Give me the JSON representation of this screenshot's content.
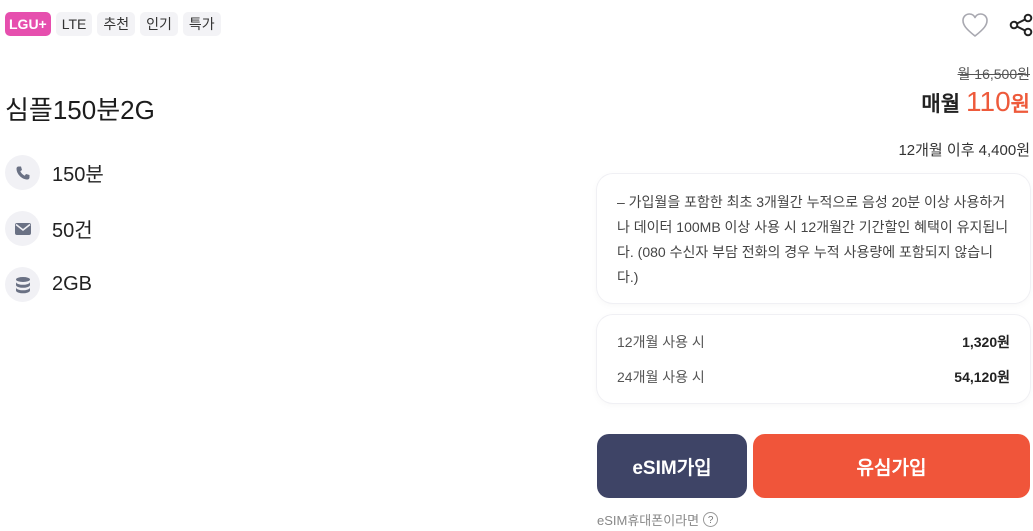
{
  "tags": [
    {
      "label": "LGU+",
      "kind": "carrier"
    },
    {
      "label": "LTE",
      "kind": "network"
    },
    {
      "label": "추천",
      "kind": "badge"
    },
    {
      "label": "인기",
      "kind": "badge"
    },
    {
      "label": "특가",
      "kind": "badge"
    }
  ],
  "plan": {
    "title": "심플150분2G"
  },
  "features": [
    {
      "icon": "phone-icon",
      "value": "150분"
    },
    {
      "icon": "message-icon",
      "value": "50건"
    },
    {
      "icon": "data-icon",
      "value": "2GB"
    }
  ],
  "price": {
    "original": "월 16,500원",
    "monthly_label": "매월",
    "monthly_amount": "110",
    "monthly_unit": "원",
    "after": "12개월 이후 4,400원"
  },
  "notice": {
    "text": "– 가입월을 포함한 최초 3개월간 누적으로 음성 20분 이상 사용하거나 데이터 100MB 이상 사용 시 12개월간 기간할인 혜택이 유지됩니다. (080 수신자 부담 전화의 경우 누적 사용량에 포함되지 않습니다.)"
  },
  "totals": [
    {
      "label": "12개월 사용 시",
      "amount": "1,320원"
    },
    {
      "label": "24개월 사용 시",
      "amount": "54,120원"
    }
  ],
  "buttons": {
    "esim": "eSIM가입",
    "usim": "유심가입"
  },
  "esim_help": {
    "text": "eSIM휴대폰이라면",
    "icon_glyph": "?"
  },
  "colors": {
    "carrier_tag": "#e64fae",
    "price_accent": "#ee5a3b",
    "esim_button": "#3e4466",
    "usim_button": "#f0553a"
  },
  "icons": {
    "favorite": "heart-icon",
    "share": "share-icon"
  }
}
